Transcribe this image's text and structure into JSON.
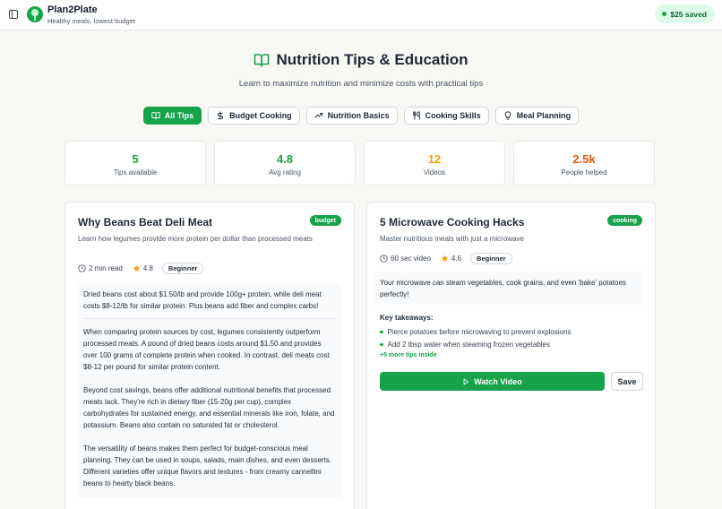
{
  "header": {
    "brand_name": "Plan2Plate",
    "brand_tagline": "Healthy meals, lowest budget",
    "saved_badge": "$25 saved"
  },
  "page": {
    "title": "Nutrition Tips & Education",
    "subtitle": "Learn to maximize nutrition and minimize costs with practical tips"
  },
  "tabs": [
    {
      "label": "All Tips",
      "icon": "book-icon",
      "active": true
    },
    {
      "label": "Budget Cooking",
      "icon": "dollar-icon",
      "active": false
    },
    {
      "label": "Nutrition Basics",
      "icon": "trending-up-icon",
      "active": false
    },
    {
      "label": "Cooking Skills",
      "icon": "utensils-icon",
      "active": false
    },
    {
      "label": "Meal Planning",
      "icon": "lightbulb-icon",
      "active": false
    }
  ],
  "stats": [
    {
      "value": "5",
      "label": "Tips available",
      "color": "#16a34a"
    },
    {
      "value": "4.8",
      "label": "Avg rating",
      "color": "#16a34a"
    },
    {
      "value": "12",
      "label": "Videos",
      "color": "#f59e0b"
    },
    {
      "value": "2.5k",
      "label": "People helped",
      "color": "#ea580c"
    }
  ],
  "cards": [
    {
      "title": "Why Beans Beat Deli Meat",
      "badge": "budget",
      "description": "Learn how legumes provide more protein per dollar than processed meats",
      "duration": "2 min read",
      "duration_icon": "clock-icon",
      "rating": "4.8",
      "level": "Beginner",
      "summary": "Dried beans cost about $1.50/lb and provide 100g+ protein, while deli meat costs $8-12/lb for similar protein. Plus beans add fiber and complex carbs!",
      "paragraphs": [
        "When comparing protein sources by cost, legumes consistently outperform processed meats. A pound of dried beans costs around $1.50 and provides over 100 grams of complete protein when cooked. In contrast, deli meats cost $8-12 per pound for similar protein content.",
        "Beyond cost savings, beans offer additional nutritional benefits that processed meats lack. They're rich in dietary fiber (15-20g per cup), complex carbohydrates for sustained energy, and essential minerals like iron, folate, and potassium. Beans also contain no saturated fat or cholesterol.",
        "The versatility of beans makes them perfect for budget-conscious meal planning. They can be used in soups, salads, main dishes, and even desserts. Different varieties offer unique flavors and textures - from creamy cannellini beans to hearty black beans."
      ]
    },
    {
      "title": "5 Microwave Cooking Hacks",
      "badge": "cooking",
      "description": "Master nutritious meals with just a microwave",
      "duration": "60 sec video",
      "duration_icon": "video-icon",
      "rating": "4.6",
      "level": "Beginner",
      "summary": "Your microwave can steam vegetables, cook grains, and even 'bake' potatoes perfectly!",
      "takeaways_label": "Key takeaways:",
      "takeaways": [
        "Pierce potatoes before microwaving to prevent explosions",
        "Add 2 tbsp water when steaming frozen vegetables"
      ],
      "more_tips": "+5 more tips inside",
      "watch_label": "Watch Video",
      "save_label": "Save"
    }
  ]
}
